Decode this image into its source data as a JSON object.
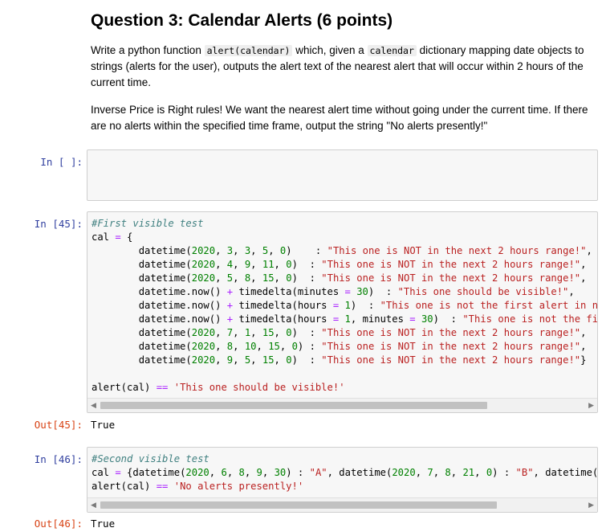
{
  "markdown": {
    "title": "Question 3: Calendar Alerts (6 points)",
    "p1_a": "Write a python function ",
    "p1_code1": "alert(calendar)",
    "p1_b": " which, given a ",
    "p1_code2": "calendar",
    "p1_c": " dictionary mapping date objects to strings (alerts for the user), outputs the alert text of the nearest alert that will occur within 2 hours of the current time.",
    "p2": "Inverse Price is Right rules! We want the nearest alert time without going under the current time. If there are no alerts within the specified time frame, output the string \"No alerts presently!\""
  },
  "cells": {
    "empty": {
      "prompt": "In [ ]:"
    },
    "c45": {
      "prompt": "In [45]:",
      "out_prompt": "Out[45]:",
      "output": "True",
      "comment": "#First visible test",
      "msg_not_range": "\"This one is NOT in the next 2 hours range!\"",
      "msg_visible": "\"This one should be visible!\"",
      "msg_not_first_a": "\"This one is not the first alert in next",
      "msg_not_first_b": "\"This one is not the first",
      "assert_str": "'This one should be visible!'"
    },
    "c46": {
      "prompt": "In [46]:",
      "out_prompt": "Out[46]:",
      "output": "True",
      "comment": "#Second visible test",
      "str_a": "\"A\"",
      "str_b": "\"B\"",
      "assert_str": "'No alerts presently!'"
    }
  },
  "scrollbars": {
    "c45_fraction_visible": 0.8,
    "c46_fraction_visible": 0.82
  }
}
